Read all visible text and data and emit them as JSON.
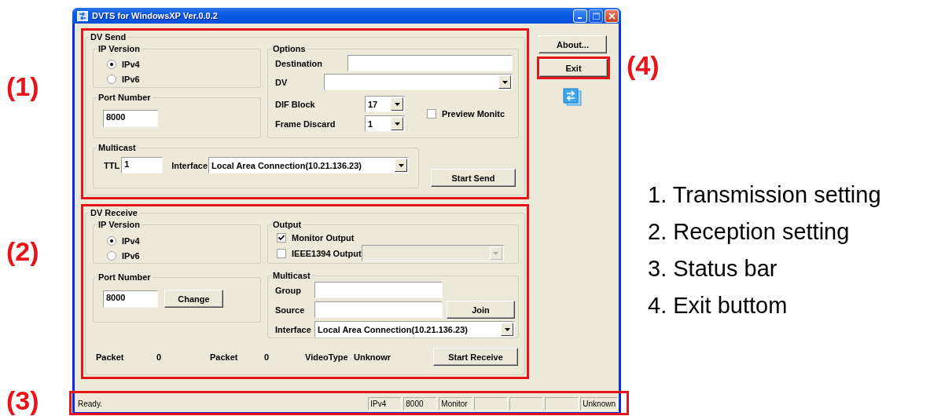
{
  "window": {
    "title": "DVTS for WindowsXP Ver.0.0.2"
  },
  "dv_send": {
    "title": "DV Send",
    "ip_version": {
      "title": "IP Version",
      "options": [
        {
          "label": "IPv4",
          "selected": true
        },
        {
          "label": "IPv6",
          "selected": false
        }
      ]
    },
    "port_number": {
      "title": "Port Number",
      "value": "8000"
    },
    "options": {
      "title": "Options",
      "destination": {
        "label": "Destination"
      },
      "dv": {
        "label": "DV"
      },
      "dif_block": {
        "label": "DIF Block",
        "value": "17"
      },
      "frame_discard": {
        "label": "Frame Discard",
        "value": "1"
      },
      "preview_monitor": {
        "label": "Preview Monitc",
        "checked": false
      }
    },
    "multicast": {
      "title": "Multicast",
      "ttl": {
        "label": "TTL",
        "value": "1"
      },
      "interface": {
        "label": "Interface",
        "value": "Local Area Connection(10.21.136.23)"
      }
    },
    "start_button": "Start Send"
  },
  "dv_receive": {
    "title": "DV Receive",
    "ip_version": {
      "title": "IP Version",
      "options": [
        {
          "label": "IPv4",
          "selected": true
        },
        {
          "label": "IPv6",
          "selected": false
        }
      ]
    },
    "port_number": {
      "title": "Port Number",
      "value": "8000",
      "button": "Change"
    },
    "output": {
      "title": "Output",
      "monitor_output": {
        "label": "Monitor Output",
        "checked": true
      },
      "ieee1394_output": {
        "label": "IEEE1394 Output",
        "checked": false,
        "dropdown_disabled": true
      }
    },
    "multicast": {
      "title": "Multicast",
      "group": {
        "label": "Group"
      },
      "source": {
        "label": "Source"
      },
      "join_button": "Join",
      "interface": {
        "label": "Interface",
        "value": "Local Area Connection(10.21.136.23)"
      }
    },
    "stats": [
      {
        "label": "Packet",
        "value": "0"
      },
      {
        "label": "Packet",
        "value": "0"
      },
      {
        "label": "VideoType",
        "value": "Unknowr"
      }
    ],
    "start_button": "Start Receive"
  },
  "side_buttons": [
    {
      "label": "About..."
    },
    {
      "label": "Exit"
    }
  ],
  "status_bar": {
    "message": "Ready.",
    "panels": [
      {
        "kind": "text",
        "text": "IPv4"
      },
      {
        "kind": "text",
        "text": "8000"
      },
      {
        "kind": "text",
        "text": "Monitor"
      },
      {
        "kind": "blank"
      },
      {
        "kind": "blank"
      },
      {
        "kind": "blank"
      },
      {
        "kind": "text",
        "text": "Unknown"
      }
    ]
  },
  "annotations": {
    "markers": [
      "(1)",
      "(2)",
      "(3)",
      "(4)"
    ],
    "legend": [
      "1. Transmission setting",
      "2. Reception setting",
      "3. Status bar",
      "4. Exit buttom"
    ]
  }
}
